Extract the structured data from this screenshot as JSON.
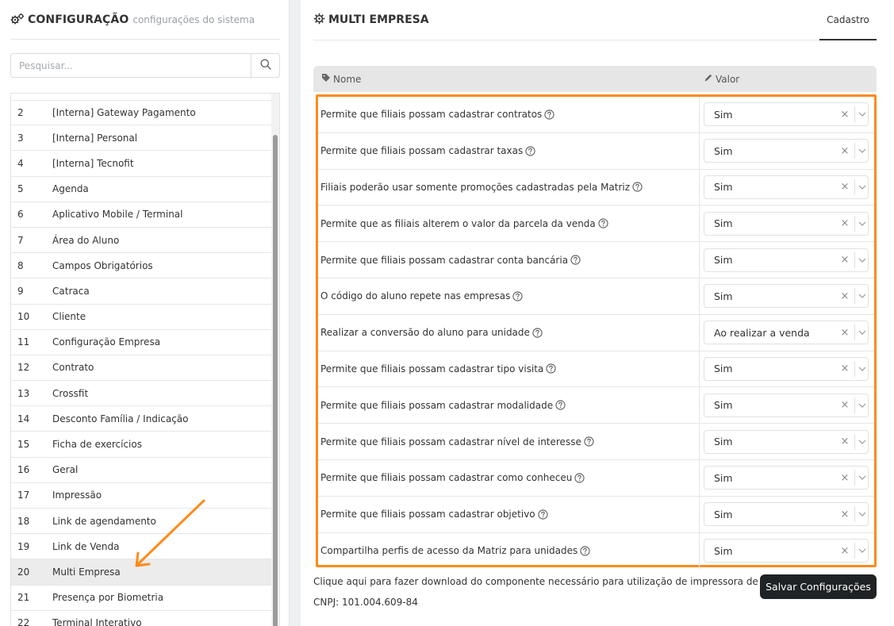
{
  "left": {
    "title": "CONFIGURAÇÃO",
    "subtitle": "configurações do sistema",
    "search_placeholder": "Pesquisar...",
    "items": [
      {
        "num": "2",
        "label": "[Interna] Gateway Pagamento"
      },
      {
        "num": "3",
        "label": "[Interna] Personal"
      },
      {
        "num": "4",
        "label": "[Interna] Tecnofit"
      },
      {
        "num": "5",
        "label": "Agenda"
      },
      {
        "num": "6",
        "label": "Aplicativo Mobile / Terminal"
      },
      {
        "num": "7",
        "label": "Área do Aluno"
      },
      {
        "num": "8",
        "label": "Campos Obrigatórios"
      },
      {
        "num": "9",
        "label": "Catraca"
      },
      {
        "num": "10",
        "label": "Cliente"
      },
      {
        "num": "11",
        "label": "Configuração Empresa"
      },
      {
        "num": "12",
        "label": "Contrato"
      },
      {
        "num": "13",
        "label": "Crossfit"
      },
      {
        "num": "14",
        "label": "Desconto Família / Indicação"
      },
      {
        "num": "15",
        "label": "Ficha de exercícios"
      },
      {
        "num": "16",
        "label": "Geral"
      },
      {
        "num": "17",
        "label": "Impressão"
      },
      {
        "num": "18",
        "label": "Link de agendamento"
      },
      {
        "num": "19",
        "label": "Link de Venda"
      },
      {
        "num": "20",
        "label": "Multi Empresa",
        "active": true
      },
      {
        "num": "21",
        "label": "Presença por Biometria"
      },
      {
        "num": "22",
        "label": "Terminal Interativo"
      }
    ]
  },
  "right": {
    "title": "MULTI EMPRESA",
    "tab": "Cadastro",
    "col_name": "Nome",
    "col_value": "Valor",
    "rows": [
      {
        "label": "Permite que filiais possam cadastrar contratos",
        "value": "Sim"
      },
      {
        "label": "Permite que filiais possam cadastrar taxas",
        "value": "Sim"
      },
      {
        "label": "Filiais poderão usar somente promoções cadastradas pela Matriz",
        "value": "Sim"
      },
      {
        "label": "Permite que as filiais alterem o valor da parcela da venda",
        "value": "Sim"
      },
      {
        "label": "Permite que filiais possam cadastrar conta bancária",
        "value": "Sim"
      },
      {
        "label": "O código do aluno repete nas empresas",
        "value": "Sim"
      },
      {
        "label": "Realizar a conversão do aluno para unidade",
        "value": "Ao realizar a venda"
      },
      {
        "label": "Permite que filiais possam cadastrar tipo visita",
        "value": "Sim"
      },
      {
        "label": "Permite que filiais possam cadastrar modalidade",
        "value": "Sim"
      },
      {
        "label": "Permite que filiais possam cadastrar nível de interesse",
        "value": "Sim"
      },
      {
        "label": "Permite que filiais possam cadastrar como conheceu",
        "value": "Sim"
      },
      {
        "label": "Permite que filiais possam cadastrar objetivo",
        "value": "Sim"
      },
      {
        "label": "Compartilha perfis de acesso da Matriz para unidades",
        "value": "Sim"
      }
    ],
    "download_text": "Clique aqui para fazer download do componente necessário para utilização de impressora de recibos",
    "cnpj": "CNPJ: 101.004.609-84",
    "save_label": "Salvar Configurações"
  },
  "colors": {
    "highlight": "#ff8a1a",
    "button_bg": "#1f2326",
    "active_row": "#ececec"
  },
  "icons": [
    "gears-icon",
    "search-icon",
    "tag-icon",
    "pencil-icon",
    "help-circle-icon",
    "clear-icon",
    "chevron-down-icon",
    "arrow-annotation"
  ]
}
